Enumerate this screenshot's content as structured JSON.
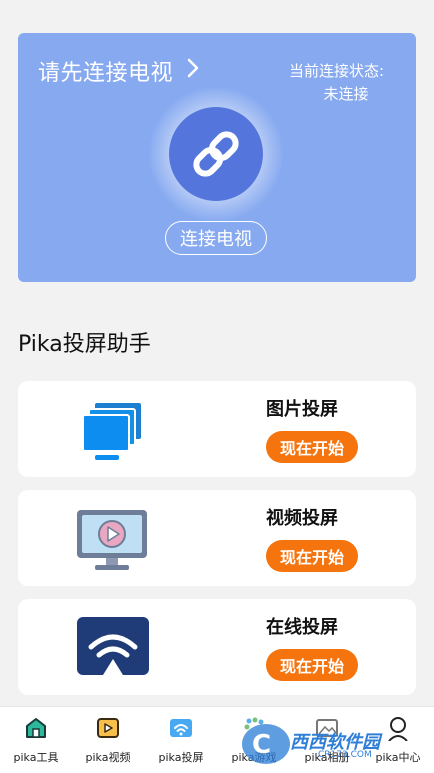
{
  "hero": {
    "title": "请先连接电视",
    "status_label": "当前连接状态:",
    "status_value": "未连接",
    "connect_button": "连接电视"
  },
  "section": {
    "title": "Pika投屏助手"
  },
  "cards": [
    {
      "title": "图片投屏",
      "button": "现在开始",
      "icon": "monitor-stack-icon"
    },
    {
      "title": "视频投屏",
      "button": "现在开始",
      "icon": "video-monitor-icon"
    },
    {
      "title": "在线投屏",
      "button": "现在开始",
      "icon": "wireless-cast-icon"
    }
  ],
  "tabs": [
    {
      "label": "pika工具",
      "icon": "home-icon"
    },
    {
      "label": "pika视频",
      "icon": "video-icon"
    },
    {
      "label": "pika投屏",
      "icon": "cast-icon"
    },
    {
      "label": "pika游戏",
      "icon": "dots-icon"
    },
    {
      "label": "pika相册",
      "icon": "photo-icon"
    },
    {
      "label": "pika中心",
      "icon": "user-icon"
    }
  ],
  "watermark": {
    "brand": "西西软件园",
    "site": "CR173.COM"
  },
  "colors": {
    "hero_bg": "#86a9f0",
    "link_circle": "#5476dc",
    "accent_orange": "#f5740d",
    "page_bg": "#f2f2f2"
  }
}
